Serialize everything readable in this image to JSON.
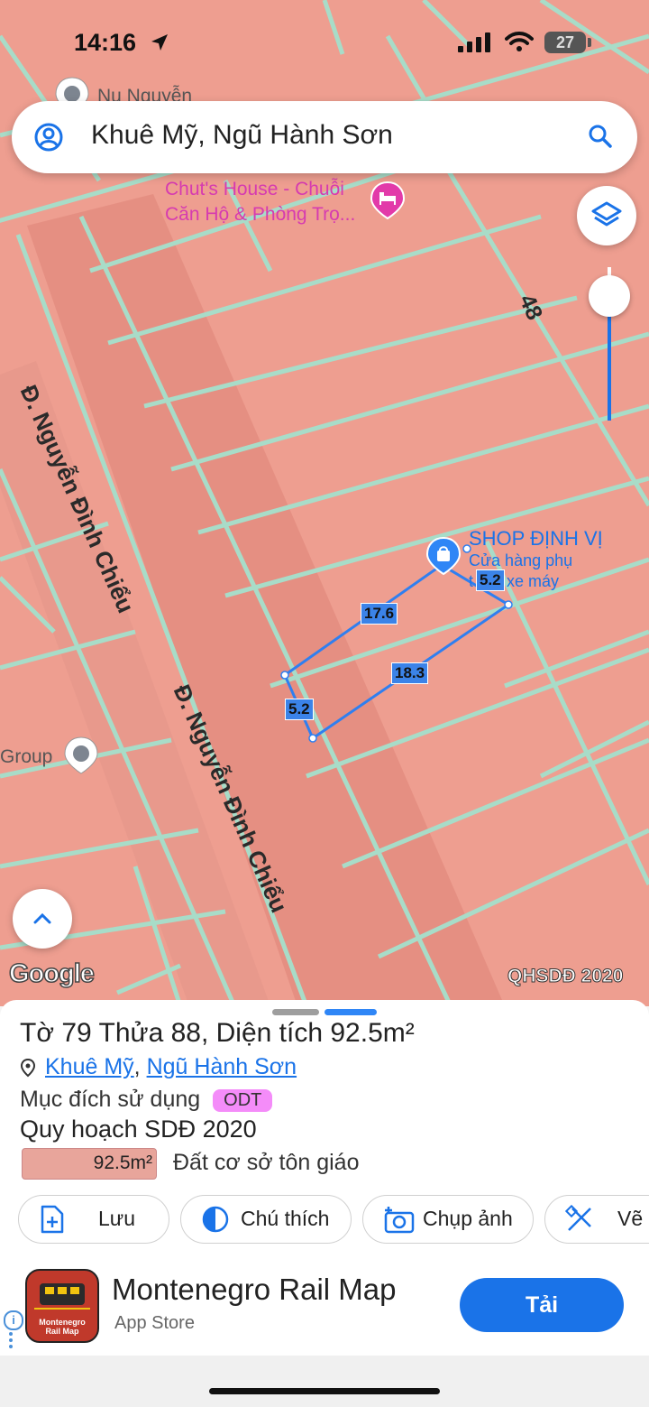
{
  "status_bar": {
    "time": "14:16",
    "battery": "27"
  },
  "search": {
    "query": "Khuê Mỹ, Ngũ Hành Sơn"
  },
  "map": {
    "poi_top_fragment": "Nu Nguyễn",
    "hotel_line1": "Chut's House - Chuỗi",
    "hotel_line2": "Căn Hộ & Phòng Trọ...",
    "shop_name": "SHOP ĐỊNH VỊ",
    "shop_line2": "Cửa hàng phụ",
    "shop_line3": "xe máy",
    "shop_line3_prefix": "t",
    "group_label": "Group",
    "street_name_1": "Đ. Nguyễn Đình Chiểu",
    "street_name_2": "Đ. Nguyễn Đình Chiểu",
    "street_number": "48",
    "measurements": {
      "left": "5.2",
      "top": "17.6",
      "right": "5.2",
      "bottom": "18.3"
    },
    "attribution": "Google",
    "layer_label": "QHSDĐ 2020",
    "colors": {
      "land": "#ee9e90",
      "roads": "#9fd8c4",
      "measure": "#3b83e8"
    }
  },
  "panel": {
    "parcel_title": "Tờ 79 Thửa 88, Diện tích 92.5m²",
    "ward_link": "Khuê Mỹ",
    "district_link": "Ngũ Hành Sơn",
    "purpose_label": "Mục đích sử dụng",
    "purpose_code": "ODT",
    "plan_label": "Quy hoạch SDĐ 2020",
    "plan_area": "92.5m²",
    "plan_desc": "Đất cơ sở tôn giáo",
    "actions": {
      "save": "Lưu",
      "legend": "Chú thích",
      "capture": "Chụp ảnh",
      "draw": "Vẽ"
    }
  },
  "ad": {
    "app_name": "Montenegro Rail Map",
    "store": "App Store",
    "cta": "Tải",
    "icon_text_1": "Montenegro",
    "icon_text_2": "Rail Map",
    "info_glyph": "i"
  }
}
